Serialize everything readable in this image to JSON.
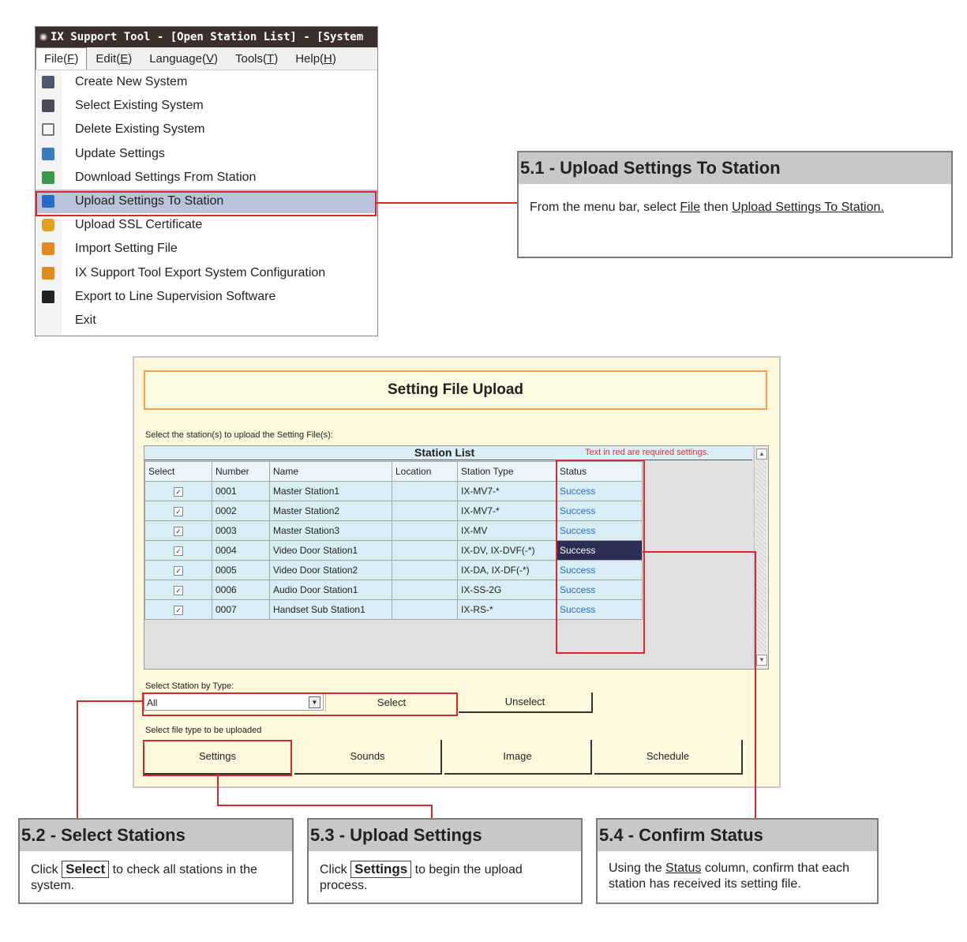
{
  "window": {
    "title": "IX Support Tool - [Open Station List] - [System",
    "menubar": [
      {
        "text": "File",
        "key": "F"
      },
      {
        "text": "Edit",
        "key": "E"
      },
      {
        "text": "Language",
        "key": "V"
      },
      {
        "text": "Tools",
        "key": "T"
      },
      {
        "text": "Help",
        "key": "H"
      }
    ],
    "file_menu": [
      {
        "label": "Create New System",
        "icon": "create-system-icon",
        "color": "#4a5a6a"
      },
      {
        "label": "Select Existing System",
        "icon": "select-system-icon",
        "color": "#4a4a5a"
      },
      {
        "label": "Delete Existing System",
        "icon": "trash-icon",
        "color": "#777777"
      },
      {
        "label": "Update Settings",
        "icon": "save-icon",
        "color": "#3b7ac0"
      },
      {
        "label": "Download Settings From Station",
        "icon": "download-icon",
        "color": "#3a9a4a"
      },
      {
        "label": "Upload Settings To Station",
        "icon": "upload-icon",
        "color": "#2a6ac8"
      },
      {
        "label": "Upload SSL Certificate",
        "icon": "lock-icon",
        "color": "#e0a020"
      },
      {
        "label": "Import Setting File",
        "icon": "import-file-icon",
        "color": "#e08a20"
      },
      {
        "label": "IX Support Tool Export System Configuration",
        "icon": "export-icon",
        "color": "#e08a20"
      },
      {
        "label": "Export to Line Supervision Software",
        "icon": "line-supervision-icon",
        "color": "#222222"
      },
      {
        "label": "Exit",
        "icon": "",
        "color": ""
      }
    ]
  },
  "callouts": {
    "c51": {
      "title": "5.1 - Upload Settings To Station",
      "pre": "From the menu bar, select ",
      "file": "File",
      "mid": " then ",
      "upload": "Upload Settings To Station."
    },
    "c52": {
      "title": "5.2 - Select Stations",
      "pre": "Click ",
      "key": "Select",
      "post": " to check all stations in the system."
    },
    "c53": {
      "title": "5.3 - Upload Settings",
      "pre": "Click ",
      "key": "Settings",
      "post": " to begin the upload process."
    },
    "c54": {
      "title": "5.4 - Confirm Status",
      "pre": "Using the ",
      "col": "Status",
      "post": " column, confirm that each station has received its setting file."
    }
  },
  "dialog": {
    "title": "Setting File Upload",
    "select_prompt": "Select the station(s) to upload the Setting File(s):",
    "list_title": "Station List",
    "required_note": "Text in red are required settings.",
    "columns": [
      "Select",
      "Number",
      "Name",
      "Location",
      "Station Type",
      "Status"
    ],
    "stations": [
      {
        "number": "0001",
        "name": "Master Station1",
        "location": "",
        "type": "IX-MV7-*",
        "status": "Success"
      },
      {
        "number": "0002",
        "name": "Master Station2",
        "location": "",
        "type": "IX-MV7-*",
        "status": "Success"
      },
      {
        "number": "0003",
        "name": "Master Station3",
        "location": "",
        "type": "IX-MV",
        "status": "Success"
      },
      {
        "number": "0004",
        "name": "Video Door Station1",
        "location": "",
        "type": "IX-DV, IX-DVF(-*)",
        "status": "Success"
      },
      {
        "number": "0005",
        "name": "Video Door Station2",
        "location": "",
        "type": "IX-DA, IX-DF(-*)",
        "status": "Success"
      },
      {
        "number": "0006",
        "name": "Audio Door Station1",
        "location": "",
        "type": "IX-SS-2G",
        "status": "Success"
      },
      {
        "number": "0007",
        "name": "Handset Sub Station1",
        "location": "",
        "type": "IX-RS-*",
        "status": "Success"
      }
    ],
    "select_by_type_label": "Select Station by Type:",
    "type_value": "All",
    "select_btn": "Select",
    "unselect_btn": "Unselect",
    "file_type_label": "Select file type to be uploaded",
    "file_types": [
      "Settings",
      "Sounds",
      "Image",
      "Schedule"
    ]
  }
}
